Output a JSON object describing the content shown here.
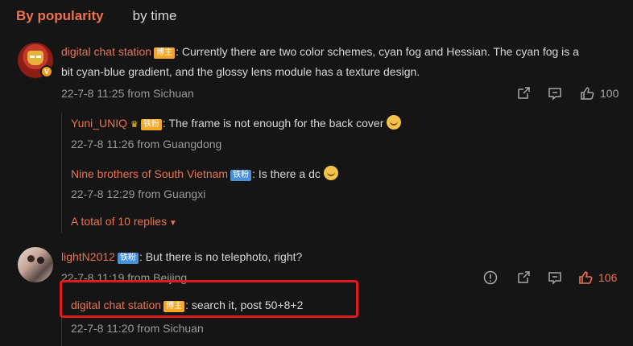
{
  "tabs": {
    "active": "By popularity",
    "other": "by time"
  },
  "comment1": {
    "user": "digital chat station",
    "badge": "博主",
    "text_line1": ": Currently there are two color schemes, cyan fog and Hessian. The cyan fog is a",
    "text_line2": "bit cyan-blue gradient, and the glossy lens module has a texture design.",
    "meta": "22-7-8 11:25 from Sichuan",
    "likes": "100",
    "replies": [
      {
        "user": "Yuni_UNIQ",
        "badge": "铁粉",
        "text": ": The frame is not enough for the back cover",
        "meta": "22-7-8 11:26 from Guangdong"
      },
      {
        "user": "Nine brothers of South Vietnam",
        "badge": "铁粉",
        "text": ": Is there a dc",
        "meta": "22-7-8 12:29 from Guangxi"
      }
    ],
    "more": "A total of 10 replies"
  },
  "comment2": {
    "user": "lightN2012",
    "badge": "铁粉",
    "text": ": But there is no telephoto, right?",
    "meta": "22-7-8 11:19 from Beijing",
    "likes": "106",
    "replies": [
      {
        "user": "digital chat station",
        "badge": "博主",
        "text": ": search it, post 50+8+2",
        "meta": "22-7-8 11:20 from Sichuan"
      }
    ]
  },
  "icons": {
    "share": "share-icon",
    "comment": "comment-icon",
    "like": "thumbs-up-icon",
    "report": "report-icon",
    "caret": "caret-down-icon"
  },
  "colors": {
    "accent": "#eb7350",
    "highlight": "#e01b1b",
    "background": "#151515"
  }
}
